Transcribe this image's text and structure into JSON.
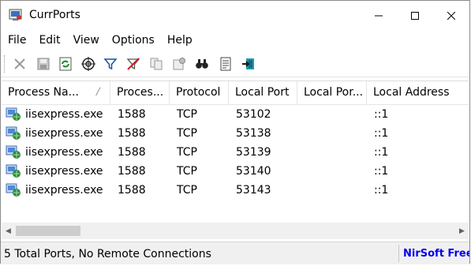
{
  "window": {
    "title": "CurrPorts"
  },
  "menu": [
    "File",
    "Edit",
    "View",
    "Options",
    "Help"
  ],
  "toolbar": [
    "close-connection-icon",
    "save-icon",
    "refresh-icon",
    "target-icon",
    "filter-icon",
    "clear-filter-icon",
    "copy-icon",
    "properties-icon",
    "find-icon",
    "report-icon",
    "exit-icon"
  ],
  "table": {
    "columns": [
      "Process Na...",
      "Proces...",
      "Protocol",
      "Local Port",
      "Local Por...",
      "Local Address"
    ],
    "rows": [
      [
        "iisexpress.exe",
        "1588",
        "TCP",
        "53102",
        "",
        "::1"
      ],
      [
        "iisexpress.exe",
        "1588",
        "TCP",
        "53138",
        "",
        "::1"
      ],
      [
        "iisexpress.exe",
        "1588",
        "TCP",
        "53139",
        "",
        "::1"
      ],
      [
        "iisexpress.exe",
        "1588",
        "TCP",
        "53140",
        "",
        "::1"
      ],
      [
        "iisexpress.exe",
        "1588",
        "TCP",
        "53143",
        "",
        "::1"
      ]
    ]
  },
  "status": {
    "text": "5 Total Ports, No Remote Connections",
    "link": "NirSoft Freeware"
  }
}
